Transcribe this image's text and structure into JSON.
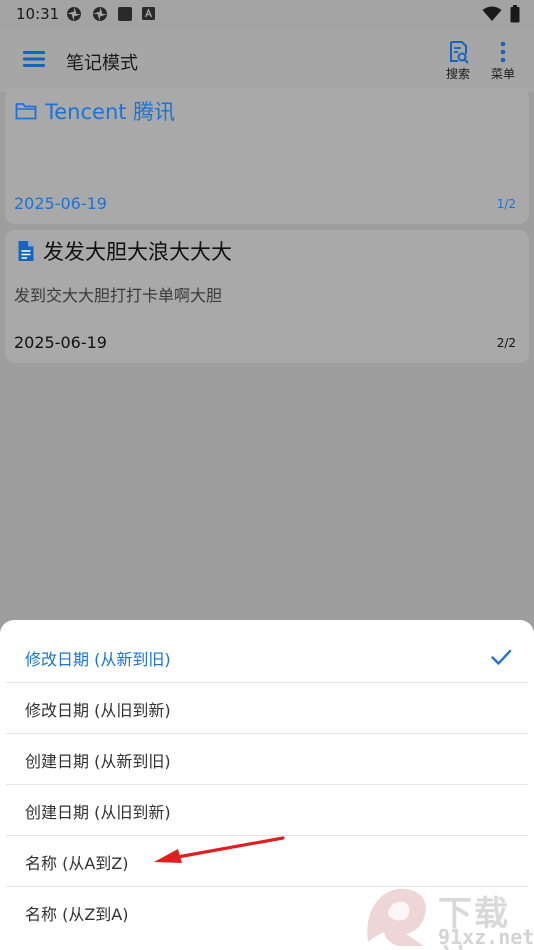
{
  "status_bar": {
    "time": "10:31",
    "icons": [
      "pinwheel-icon",
      "pinwheel-icon",
      "square-icon",
      "a-badge-icon"
    ],
    "right_icons": [
      "wifi-icon",
      "battery-icon"
    ]
  },
  "app_bar": {
    "title": "笔记模式",
    "search_label": "搜索",
    "menu_label": "菜单"
  },
  "notes": [
    {
      "title": "Tencent 腾讯",
      "icon": "folder-icon",
      "preview": "",
      "date": "2025-06-19",
      "page": "1/2",
      "accent": "#1a73d9"
    },
    {
      "title": "发发大胆大浪大大大",
      "icon": "document-icon",
      "preview": "发到交大大胆打打卡单啊大胆",
      "date": "2025-06-19",
      "page": "2/2",
      "accent": "#1565c0"
    }
  ],
  "sort_sheet": {
    "options": [
      {
        "label": "修改日期 (从新到旧)",
        "selected": true
      },
      {
        "label": "修改日期 (从旧到新)",
        "selected": false
      },
      {
        "label": "创建日期 (从新到旧)",
        "selected": false
      },
      {
        "label": "创建日期 (从旧到新)",
        "selected": false
      },
      {
        "label": "名称 (从A到Z)",
        "selected": false
      },
      {
        "label": "名称 (从Z到A)",
        "selected": false
      }
    ]
  },
  "colors": {
    "accent": "#1a73d9",
    "arrow": "#e02020"
  },
  "watermark": {
    "line1": "下载站",
    "line2": "91xz.net"
  }
}
